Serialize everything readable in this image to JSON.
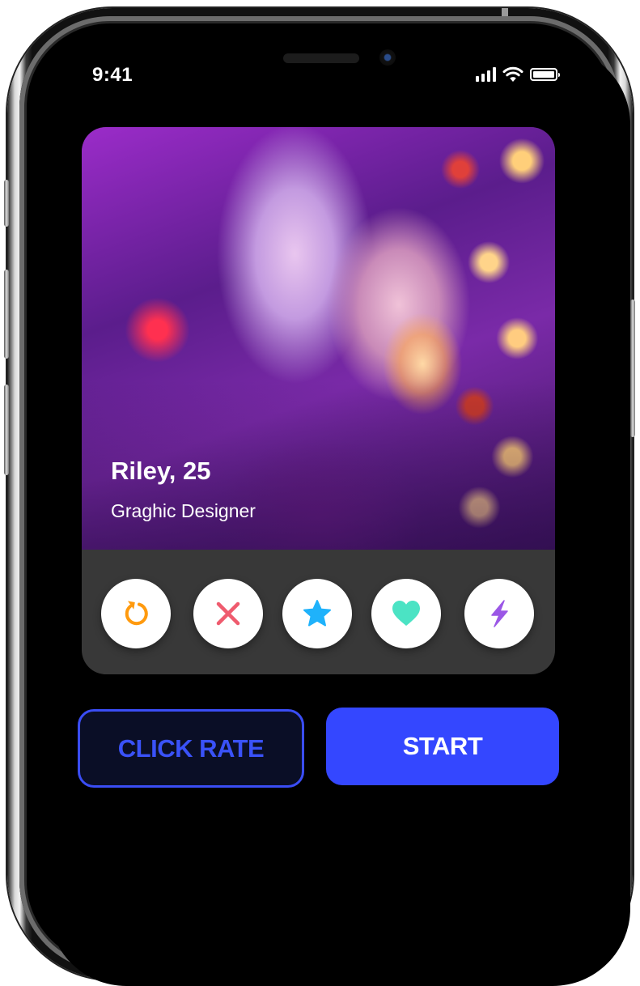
{
  "status_bar": {
    "time": "9:41",
    "icons": [
      "cellular-signal-icon",
      "wifi-icon",
      "battery-icon"
    ]
  },
  "profile_card": {
    "name_age": "Riley, 25",
    "occupation": "Graghic Designer",
    "photo": "portrait-photo"
  },
  "actions": [
    {
      "id": "rewind",
      "icon": "rewind-icon",
      "color": "#FF9A0E"
    },
    {
      "id": "nope",
      "icon": "close-icon",
      "color": "#EF5B6E"
    },
    {
      "id": "super-like",
      "icon": "star-icon",
      "color": "#1FB2FB"
    },
    {
      "id": "like",
      "icon": "heart-icon",
      "color": "#4BE3C4"
    },
    {
      "id": "boost",
      "icon": "lightning-icon",
      "color": "#9B57E6"
    }
  ],
  "buttons": {
    "secondary_label": "CLICK RATE",
    "primary_label": "START"
  },
  "colors": {
    "accent_blue": "#3447FF",
    "outline_button_bg": "#0A0E26",
    "card_panel": "#383838"
  }
}
